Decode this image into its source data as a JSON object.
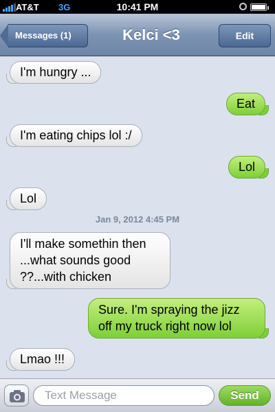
{
  "status_bar": {
    "carrier": "AT&T",
    "network": "3G",
    "time": "10:41 PM"
  },
  "nav": {
    "back_label": "Messages (1)",
    "title": "Kelci <3",
    "edit_label": "Edit"
  },
  "messages": [
    {
      "direction": "incoming",
      "text": "I'm hungry ..."
    },
    {
      "direction": "outgoing",
      "text": "Eat"
    },
    {
      "direction": "incoming",
      "text": "I'm eating chips lol :/"
    },
    {
      "direction": "outgoing",
      "text": "Lol"
    },
    {
      "direction": "incoming",
      "text": "Lol"
    },
    {
      "direction": "incoming",
      "text": "I'll make somethin then ...what sounds good ??...with chicken"
    },
    {
      "direction": "outgoing",
      "text": "Sure. I'm spraying the jizz off my truck right now lol"
    },
    {
      "direction": "incoming",
      "text": "Lmao !!!"
    }
  ],
  "timestamp": "Jan 9, 2012 4:45 PM",
  "composer": {
    "placeholder": "Text Message",
    "send_label": "Send"
  },
  "colors": {
    "incoming_bubble": "#ffffff",
    "outgoing_bubble": "#8fd646",
    "background": "#dbe2ed"
  }
}
